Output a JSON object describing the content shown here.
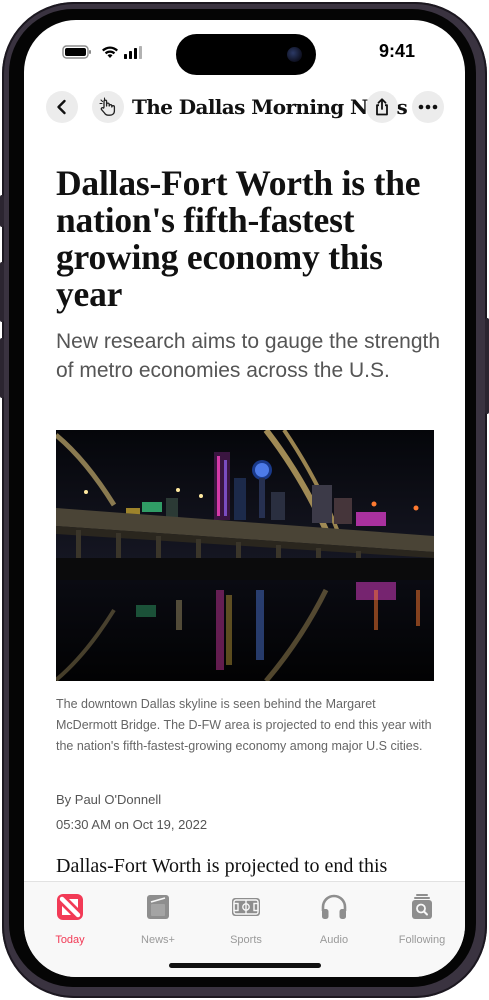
{
  "status_bar": {
    "time": "9:41"
  },
  "navbar": {
    "back_icon": "chevron-left-icon",
    "publication_icon": "hand-pointer-icon",
    "publication_name": "The Dallas Morning News",
    "share_icon": "share-icon",
    "more_icon": "ellipsis-icon"
  },
  "article": {
    "headline": "Dallas-Fort Worth is the nation's fifth-fastest growing economy this year",
    "subhead": "New research aims to gauge the strength of metro economies across the U.S.",
    "image_caption": "The downtown Dallas skyline is seen behind the Margaret McDermott Bridge. The D-FW area is projected to end this year with the nation's fifth-fastest-growing economy among major U.S cities.",
    "byline": "By Paul O'Donnell",
    "timestamp": "05:30 AM on Oct 19, 2022",
    "body_preview": "Dallas-Fort Worth is projected to end this"
  },
  "tabbar": {
    "active_color": "#f23a56",
    "inactive_color": "#9a9a9a",
    "tabs": [
      {
        "label": "Today",
        "icon": "news-today-icon",
        "active": true
      },
      {
        "label": "News+",
        "icon": "news-plus-icon",
        "active": false
      },
      {
        "label": "Sports",
        "icon": "sports-field-icon",
        "active": false
      },
      {
        "label": "Audio",
        "icon": "headphones-icon",
        "active": false
      },
      {
        "label": "Following",
        "icon": "following-icon",
        "active": false
      }
    ]
  }
}
